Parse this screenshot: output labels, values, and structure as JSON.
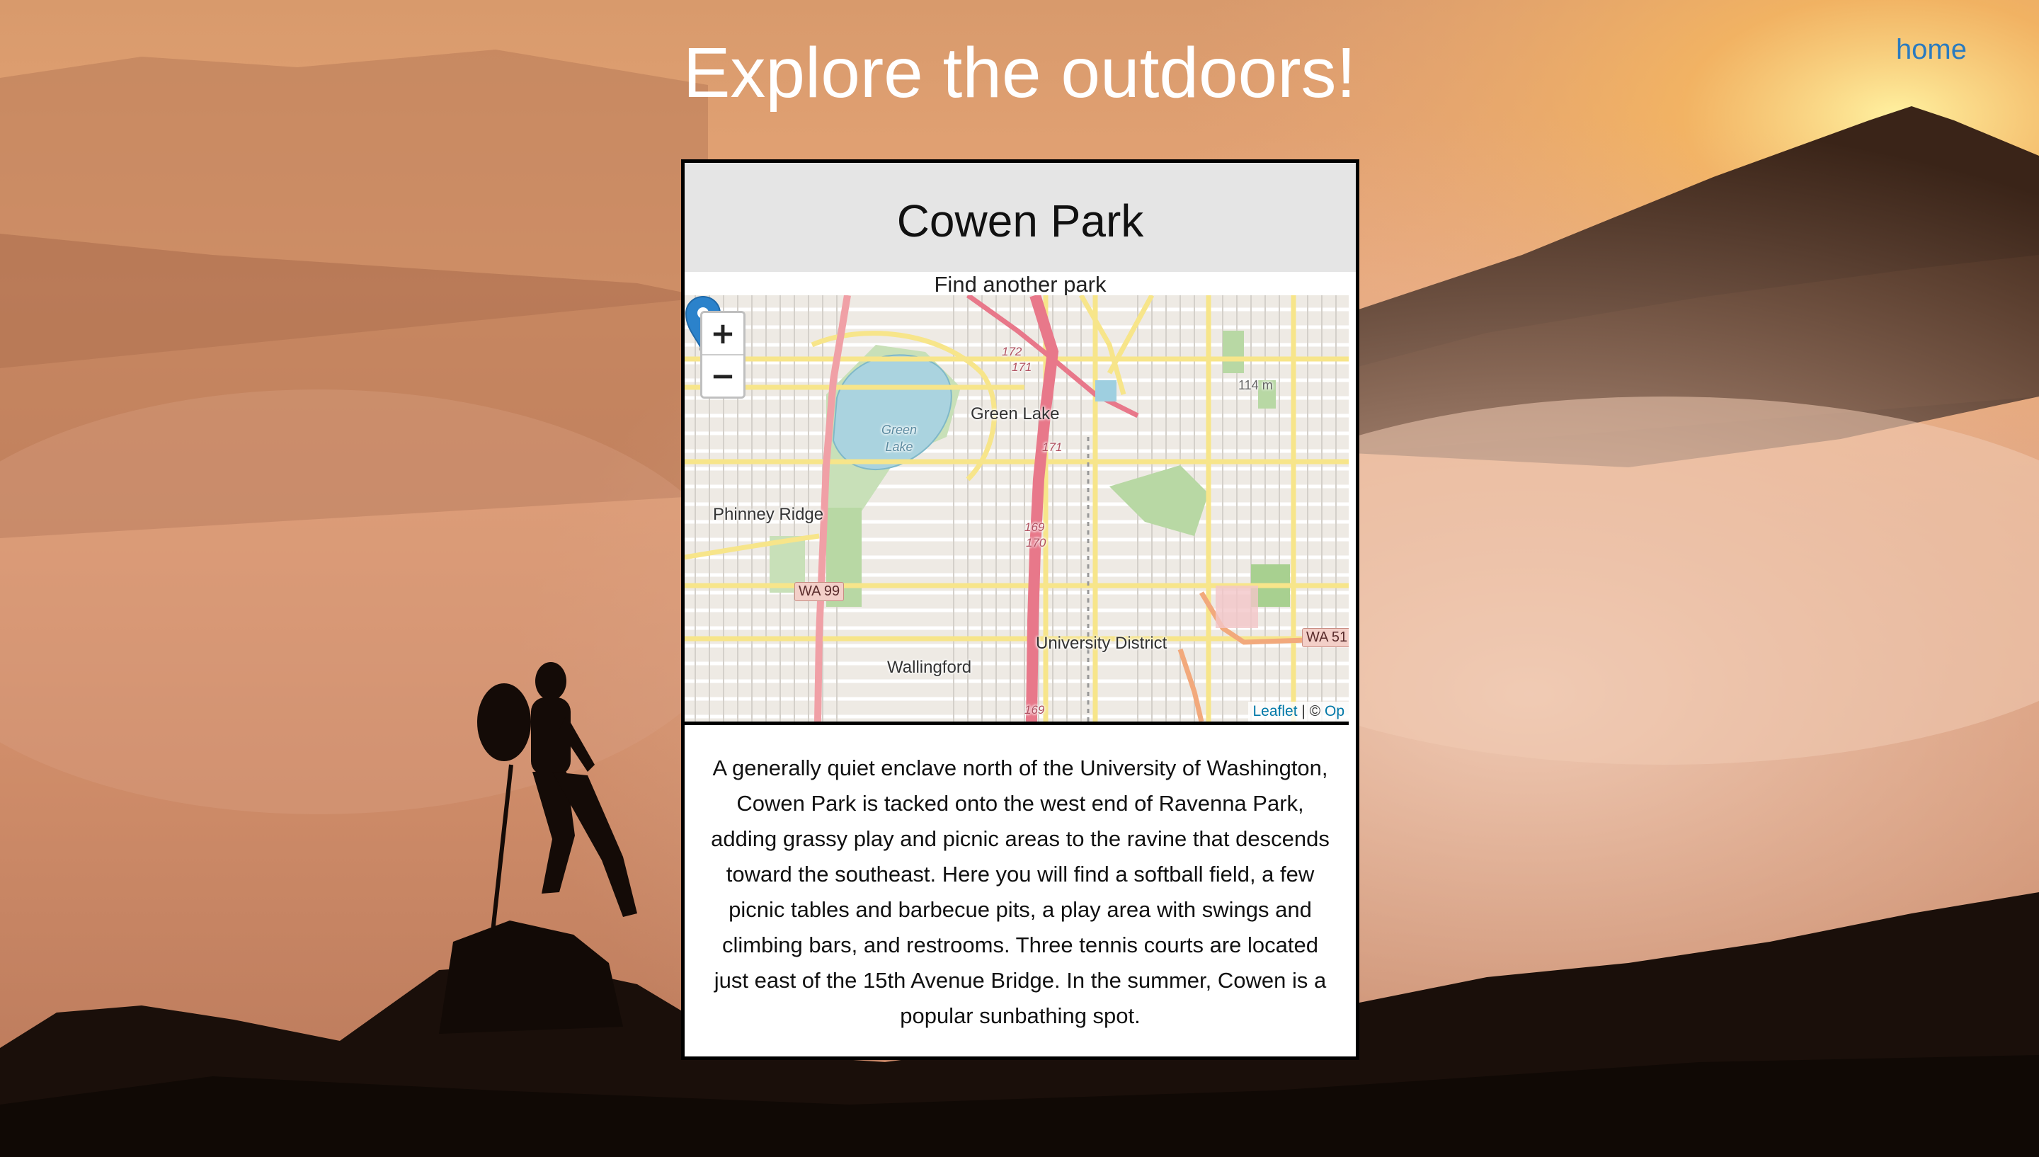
{
  "header": {
    "title": "Explore the outdoors!",
    "home_label": "home"
  },
  "park": {
    "name": "Cowen Park",
    "find_another_label": "Find another park",
    "description": "A generally quiet enclave north of the University of Washington, Cowen Park is tacked onto the west end of Ravenna Park, adding grassy play and picnic areas to the ravine that descends toward the southeast. Here you will find a softball field, a few picnic tables and barbecue pits, a play area with swings and climbing bars, and restrooms. Three tennis courts are located just east of the 15th Avenue Bridge. In the summer, Cowen is a popular sunbathing spot."
  },
  "map": {
    "zoom_in_label": "+",
    "zoom_out_label": "−",
    "attribution_leaflet": "Leaflet",
    "attribution_sep": " | © ",
    "attribution_osm": "Op",
    "labels": {
      "green_lake": "Green Lake",
      "green_lake_water": "Green Lake",
      "phinney_ridge": "Phinney Ridge",
      "university_district": "University District",
      "wallingford": "Wallingford",
      "elevation": "114 m"
    },
    "shields": {
      "wa99": "WA 99",
      "wa51": "WA 51"
    },
    "exits": [
      "172",
      "171",
      "171",
      "169",
      "170",
      "169"
    ],
    "marker_icon": "map-pin-icon",
    "marker_color": "#2b82cb"
  },
  "colors": {
    "link": "#2a7bc0",
    "card_header_bg": "#e5e5e5",
    "card_border": "#000000"
  }
}
